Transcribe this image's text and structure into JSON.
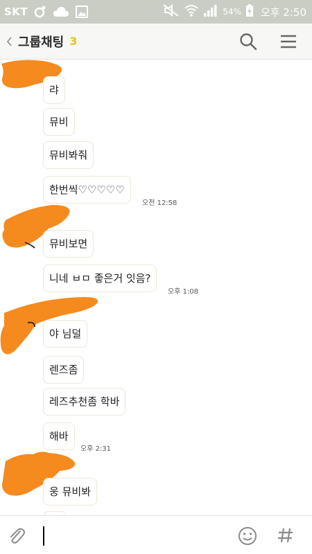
{
  "status_bar": {
    "carrier": "SKT",
    "battery": "54%",
    "time": "오후 2:50"
  },
  "header": {
    "title": "그룹채팅",
    "member_count": "3"
  },
  "messages": [
    {
      "text": "랴"
    },
    {
      "text": "뮤비"
    },
    {
      "text": "뮤비봐줘"
    },
    {
      "text": "한번씩♡♡♡♡♡",
      "time": "오전 12:58"
    },
    {
      "text": "뮤비보면"
    },
    {
      "text": "니네 ㅂㅁ 좋은거 잇음?",
      "time": "오후 1:08"
    },
    {
      "text": "야 님덜"
    },
    {
      "text": "렌즈좀"
    },
    {
      "text": "레즈추천좀 학바"
    },
    {
      "text": "해바",
      "time": "오후 2:31"
    },
    {
      "text": "웅 뮤비봐"
    },
    {
      "text": ""
    }
  ],
  "input": {
    "placeholder": ""
  },
  "colors": {
    "status_bar_bg": "#c9cdc3",
    "member_count": "#e6c320",
    "avatar_scribble": "#f58a1f",
    "bubble_border": "#ece7d6"
  }
}
